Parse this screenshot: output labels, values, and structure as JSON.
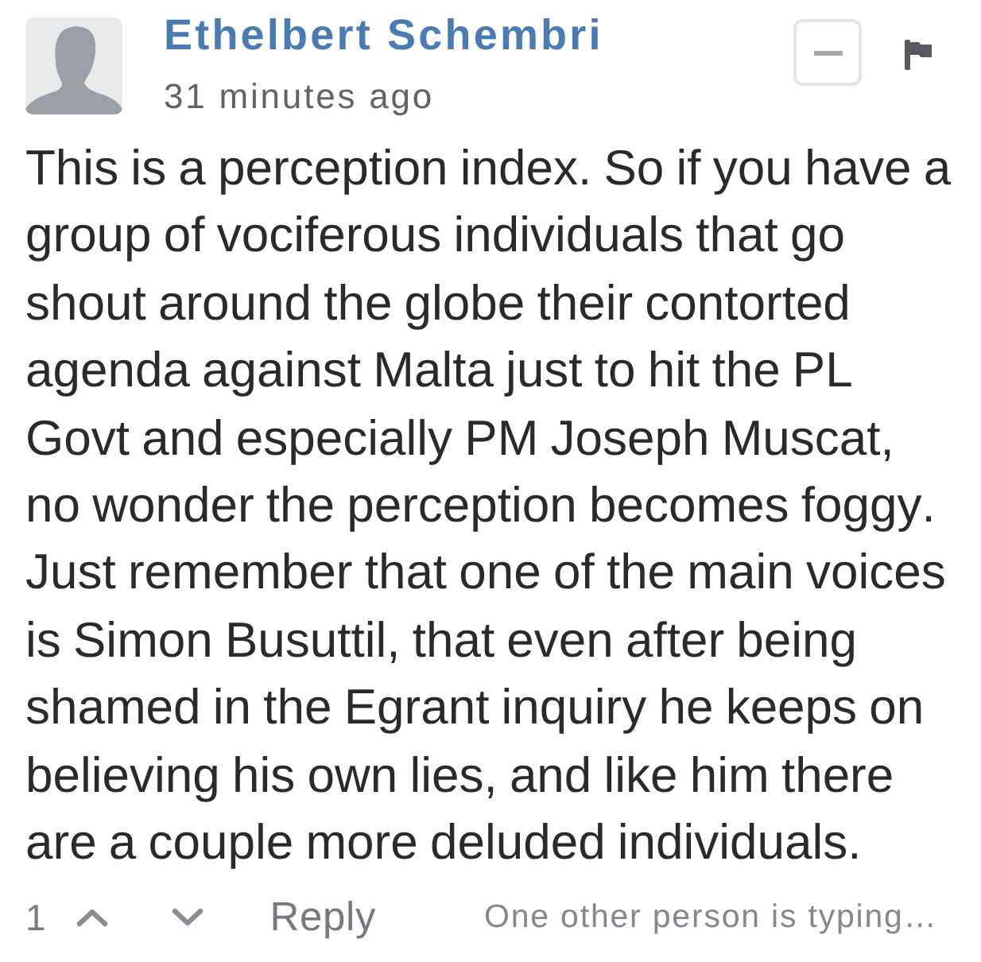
{
  "comment": {
    "author": "Ethelbert Schembri",
    "time": "31 minutes ago",
    "body": "This is a perception index. So if you have a group of vociferous individuals that go shout around the globe their contorted agenda against Malta just to hit the PL Govt and especially PM Joseph Muscat, no wonder the perception becomes foggy. Just remember that one of the main voices is Simon Busuttil, that even after being shamed in the Egrant inquiry he keeps on believing his own lies, and like him there are a couple more deluded individuals."
  },
  "footer": {
    "votes": "1",
    "reply": "Reply",
    "typing": "One other person is typing…"
  }
}
